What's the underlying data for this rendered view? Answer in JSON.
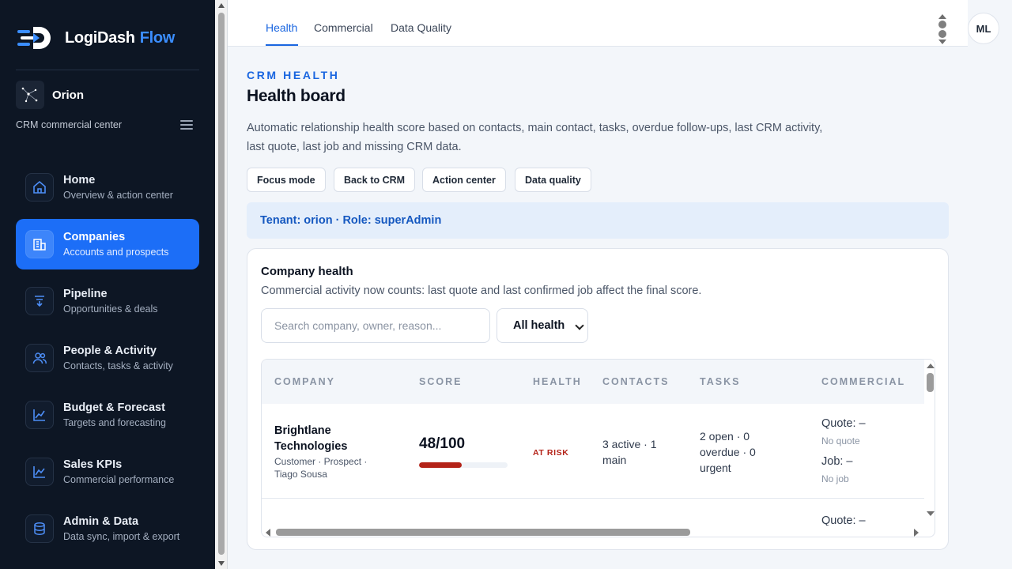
{
  "brand": {
    "name": "LogiDash",
    "accent": "Flow",
    "accent_color": "#3b8eff"
  },
  "tenant": {
    "name": "Orion",
    "subtitle": "CRM commercial center"
  },
  "nav": [
    {
      "title": "Home",
      "sub": "Overview & action center",
      "icon": "home-icon"
    },
    {
      "title": "Companies",
      "sub": "Accounts and prospects",
      "icon": "building-icon",
      "active": true
    },
    {
      "title": "Pipeline",
      "sub": "Opportunities & deals",
      "icon": "funnel-icon"
    },
    {
      "title": "People & Activity",
      "sub": "Contacts, tasks & activity",
      "icon": "people-icon"
    },
    {
      "title": "Budget & Forecast",
      "sub": "Targets and forecasting",
      "icon": "chart-line-icon"
    },
    {
      "title": "Sales KPIs",
      "sub": "Commercial performance",
      "icon": "trend-icon"
    },
    {
      "title": "Admin & Data",
      "sub": "Data sync, import & export",
      "icon": "database-icon"
    }
  ],
  "tabs": [
    {
      "label": "Health",
      "active": true
    },
    {
      "label": "Commercial"
    },
    {
      "label": "Data Quality"
    }
  ],
  "user": {
    "initials": "ML"
  },
  "page": {
    "eyebrow": "CRM HEALTH",
    "title": "Health board",
    "description": "Automatic relationship health score based on contacts, main contact, tasks, overdue follow-ups, last CRM activity, last quote, last job and missing CRM data.",
    "actions": [
      "Focus mode",
      "Back to CRM",
      "Action center",
      "Data quality"
    ],
    "banner": "Tenant: orion · Role: superAdmin"
  },
  "card": {
    "title": "Company health",
    "subtitle": "Commercial activity now counts: last quote and last confirmed job affect the final score.",
    "search_placeholder": "Search company, owner, reason...",
    "filter_value": "All health"
  },
  "table": {
    "headers": [
      "COMPANY",
      "SCORE",
      "HEALTH",
      "CONTACTS",
      "TASKS",
      "COMMERCIAL"
    ],
    "rows": [
      {
        "company": "Brightlane Technologies",
        "meta": "Customer · Prospect · Tiago Sousa",
        "score": "48/100",
        "score_value": 48,
        "health": "AT RISK",
        "health_color": "#b42318",
        "contacts": "3 active · 1 main",
        "tasks": "2 open · 0 overdue · 0 urgent",
        "quote": "Quote: –",
        "quote_sub": "No quote",
        "job": "Job: –",
        "job_sub": "No job"
      },
      {
        "quote": "Quote: –"
      }
    ]
  }
}
